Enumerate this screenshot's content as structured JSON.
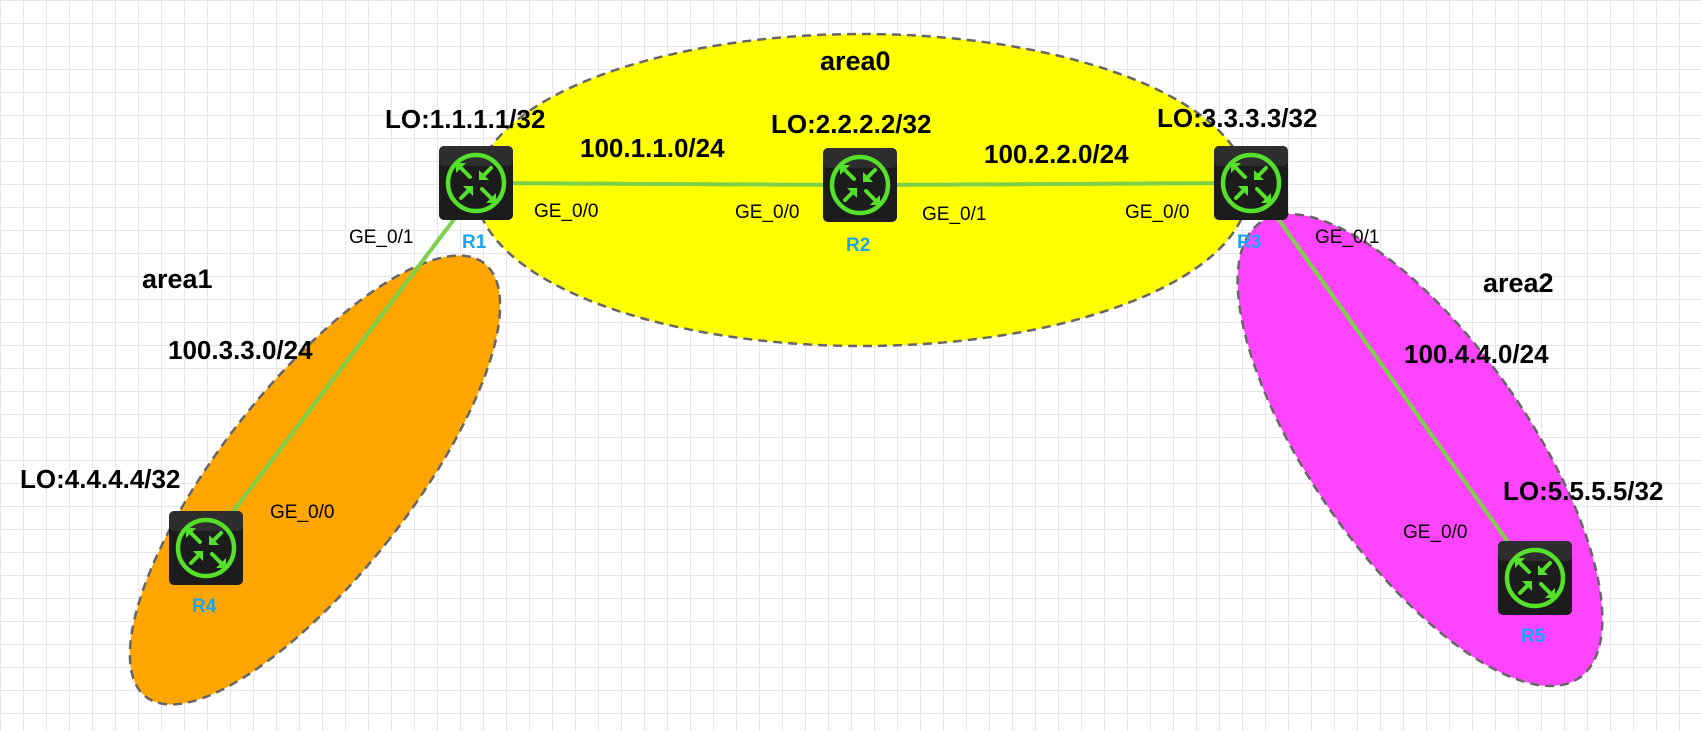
{
  "colors": {
    "area0": "#ffff00",
    "area1": "#ffa500",
    "area2": "#ff44ff",
    "link": "#7cd04a",
    "router_body": "#1c1c1c",
    "router_accent": "#55e02a",
    "router_label": "#1aa5f0"
  },
  "areas": [
    {
      "id": "area0",
      "label": "area0"
    },
    {
      "id": "area1",
      "label": "area1"
    },
    {
      "id": "area2",
      "label": "area2"
    }
  ],
  "routers": [
    {
      "id": "R1",
      "label": "R1",
      "loopback": "LO:1.1.1.1/32",
      "icon": "router-icon"
    },
    {
      "id": "R2",
      "label": "R2",
      "loopback": "LO:2.2.2.2/32",
      "icon": "router-icon"
    },
    {
      "id": "R3",
      "label": "R3",
      "loopback": "LO:3.3.3.3/32",
      "icon": "router-icon"
    },
    {
      "id": "R4",
      "label": "R4",
      "loopback": "LO:4.4.4.4/32",
      "icon": "router-icon"
    },
    {
      "id": "R5",
      "label": "R5",
      "loopback": "LO:5.5.5.5/32",
      "icon": "router-icon"
    }
  ],
  "links": [
    {
      "from": "R1",
      "to": "R2",
      "network": "100.1.1.0/24",
      "from_if": "GE_0/0",
      "to_if": "GE_0/0"
    },
    {
      "from": "R2",
      "to": "R3",
      "network": "100.2.2.0/24",
      "from_if": "GE_0/1",
      "to_if": "GE_0/0"
    },
    {
      "from": "R1",
      "to": "R4",
      "network": "100.3.3.0/24",
      "from_if": "GE_0/1",
      "to_if": "GE_0/0"
    },
    {
      "from": "R3",
      "to": "R5",
      "network": "100.4.4.0/24",
      "from_if": "GE_0/1",
      "to_if": "GE_0/0"
    }
  ]
}
